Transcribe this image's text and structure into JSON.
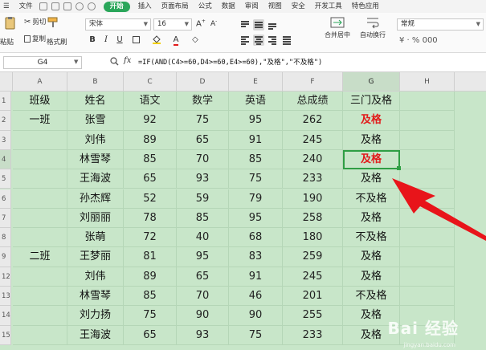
{
  "menu": {
    "file_label": "文件",
    "tabs": [
      "开始",
      "插入",
      "页面布局",
      "公式",
      "数据",
      "审阅",
      "视图",
      "安全",
      "开发工具",
      "特色应用"
    ],
    "active_tab": "开始"
  },
  "toolbar": {
    "cut_label": "剪切",
    "copy_label": "复制",
    "format_painter_label": "格式刷",
    "paste_label": "粘贴",
    "font_name": "宋体",
    "font_size": "16",
    "merge_label": "合并居中",
    "wrap_label": "自动换行",
    "number_format": "常规",
    "bold_glyph": "B",
    "italic_glyph": "I",
    "underline_glyph": "U"
  },
  "formula_bar": {
    "name_box": "G4",
    "fx_label": "fx",
    "formula": "=IF(AND(C4>=60,D4>=60,E4>=60),\"及格\",\"不及格\")"
  },
  "sheet": {
    "columns": [
      "A",
      "B",
      "C",
      "D",
      "E",
      "F",
      "G",
      "H"
    ],
    "selected_column": "G",
    "row_numbers": [
      "1",
      "2",
      "3",
      "4",
      "5",
      "6",
      "7",
      "8",
      "9",
      "12",
      "13",
      "14",
      "15"
    ],
    "selected_row": "4",
    "rows": [
      [
        "班级",
        "姓名",
        "语文",
        "数学",
        "英语",
        "总成绩",
        "三门及格",
        ""
      ],
      [
        "一班",
        "张雪",
        "92",
        "75",
        "95",
        "262",
        "及格",
        ""
      ],
      [
        "",
        "刘伟",
        "89",
        "65",
        "91",
        "245",
        "及格",
        ""
      ],
      [
        "",
        "林雪琴",
        "85",
        "70",
        "85",
        "240",
        "及格",
        ""
      ],
      [
        "",
        "王海波",
        "65",
        "93",
        "75",
        "233",
        "及格",
        ""
      ],
      [
        "",
        "孙杰辉",
        "52",
        "59",
        "79",
        "190",
        "不及格",
        ""
      ],
      [
        "",
        "刘丽丽",
        "78",
        "85",
        "95",
        "258",
        "及格",
        ""
      ],
      [
        "",
        "张萌",
        "72",
        "40",
        "68",
        "180",
        "不及格",
        ""
      ],
      [
        "二班",
        "王梦丽",
        "81",
        "95",
        "83",
        "259",
        "及格",
        ""
      ],
      [
        "",
        "刘伟",
        "89",
        "65",
        "91",
        "245",
        "及格",
        ""
      ],
      [
        "",
        "林雪琴",
        "85",
        "70",
        "46",
        "201",
        "不及格",
        ""
      ],
      [
        "",
        "刘力扬",
        "75",
        "90",
        "90",
        "255",
        "及格",
        ""
      ],
      [
        "",
        "王海波",
        "65",
        "93",
        "75",
        "233",
        "及格",
        ""
      ]
    ],
    "red_cells": [
      [
        1,
        6
      ],
      [
        3,
        6
      ]
    ],
    "active_cell": [
      3,
      6
    ]
  },
  "watermark": {
    "text": "Bai 经验",
    "sub": "jingyan.baidu.com"
  },
  "colors": {
    "accent": "#2aa65a",
    "sheet_bg": "#c8e6c9",
    "highlight_text": "#e21b1b",
    "arrow": "#e8141a"
  }
}
